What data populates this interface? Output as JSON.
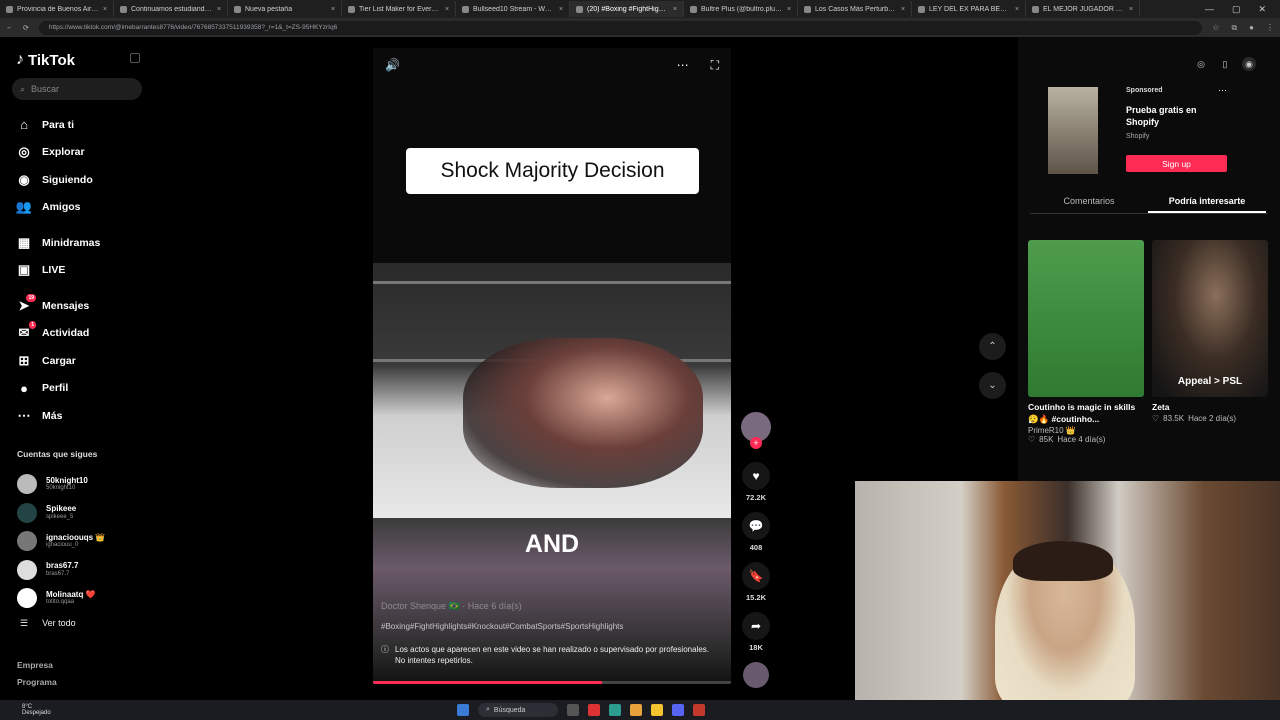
{
  "browser": {
    "tabs": [
      {
        "title": "Provincia de Buenos Aires |",
        "active": false
      },
      {
        "title": "Continuamos estudiando – Pl...",
        "active": false
      },
      {
        "title": "Nueva pestaña",
        "active": false
      },
      {
        "title": "Tier List Maker for Everything",
        "active": false
      },
      {
        "title": "Bullseed10 Stream - Watch Liv...",
        "active": false
      },
      {
        "title": "(20) #Boxing #FightHighli...",
        "active": true
      },
      {
        "title": "Bultre Plus (@bultro.plus) | TikT...",
        "active": false
      },
      {
        "title": "Los Casos Más Perturbadores d...",
        "active": false
      },
      {
        "title": "LEY DEL EX PARA BELMONTE Y...",
        "active": false
      },
      {
        "title": "EL MEJOR JUGADOR ACTUAL d...",
        "active": false
      }
    ],
    "url": "https://www.tiktok.com/@imebarrantes8776/video/7676857337511939358?_r=1&_t=ZS-95HKYzrIq6"
  },
  "sidebar": {
    "logo": "TikTok",
    "search_placeholder": "Buscar",
    "nav": [
      {
        "label": "Para ti",
        "icon": "home-icon"
      },
      {
        "label": "Explorar",
        "icon": "compass-icon"
      },
      {
        "label": "Siguiendo",
        "icon": "following-icon"
      },
      {
        "label": "Amigos",
        "icon": "friends-icon"
      },
      {
        "label": "Minidramas",
        "icon": "film-icon"
      },
      {
        "label": "LIVE",
        "icon": "live-icon"
      },
      {
        "label": "Mensajes",
        "icon": "send-icon",
        "badge": "19"
      },
      {
        "label": "Actividad",
        "icon": "inbox-icon",
        "badge": "1"
      },
      {
        "label": "Cargar",
        "icon": "plus-icon"
      },
      {
        "label": "Perfil",
        "icon": "profile-icon"
      },
      {
        "label": "Más",
        "icon": "more-icon"
      }
    ],
    "following_title": "Cuentas que sigues",
    "following": [
      {
        "name": "50knight10",
        "handle": "50knight10"
      },
      {
        "name": "Spikeee",
        "handle": "spikeee_5"
      },
      {
        "name": "ignacioouqs 👑",
        "handle": "ignaciouu_0"
      },
      {
        "name": "bras67.7",
        "handle": "bras67.7"
      },
      {
        "name": "Molinaatq ❤️",
        "handle": "totito.qqaa"
      }
    ],
    "see_all": "Ver todo",
    "footer": [
      "Empresa",
      "Programa"
    ]
  },
  "video": {
    "caption_box": "Shock Majority Decision",
    "subtitle": "AND",
    "author": "Doctor Shenque 🇧🇷 · Hace 6 día(s)",
    "hashtags": "#Boxing#FightHighlights#Knockout#CombatSports#SportsHighlights",
    "disclaimer": "Los actos que aparecen en este video se han realizado o supervisado por profesionales. No intentes repetirlos.",
    "progress": 0.64
  },
  "actions": {
    "likes": "72.2K",
    "comments": "408",
    "saves": "15.2K",
    "shares": "18K"
  },
  "right_panel": {
    "ad": {
      "sponsored": "Sponsored",
      "title": "Prueba gratis en Shopify",
      "brand": "Shopify",
      "button": "Sign up"
    },
    "tabs": [
      "Comentarios",
      "Podría interesarte"
    ],
    "active_tab": 1,
    "cards": [
      {
        "caption": "Coutinho is magic in skills 😮‍💨🔥 #coutinho...",
        "author": "PrimeR10 👑",
        "likes": "85K",
        "age": "Hace 4 día(s)",
        "overlay": ""
      },
      {
        "caption": "Zeta",
        "author": "",
        "likes": "83.5K",
        "age": "Hace 2 día(s)",
        "overlay": "Appeal > PSL"
      }
    ]
  },
  "taskbar": {
    "weather_temp": "8°C",
    "weather_desc": "Despejado",
    "search": "Búsqueda"
  }
}
